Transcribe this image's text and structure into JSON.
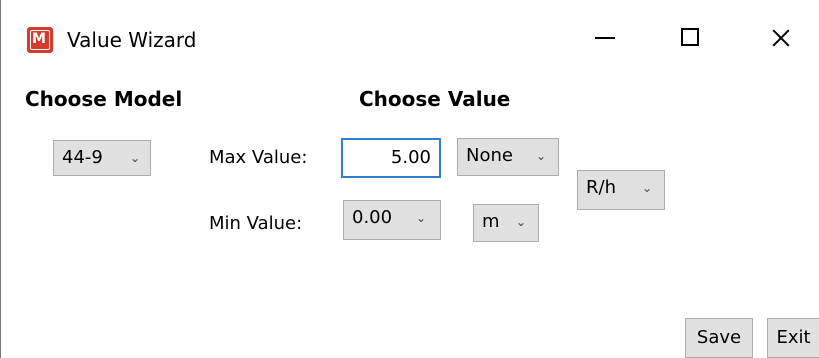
{
  "window": {
    "title": "Value Wizard",
    "icon": "app-logo-icon",
    "accent_color": "#d63a2e"
  },
  "left": {
    "heading": "Choose Model",
    "model_select": {
      "value": "44-9"
    }
  },
  "center": {
    "heading": "Choose Value",
    "max_label": "Max Value:",
    "max_value": "5.00",
    "min_label": "Min Value:",
    "min_select": {
      "value": "0.00"
    },
    "max_prefix_select": {
      "value": "None"
    },
    "min_prefix_select": {
      "value": "m"
    },
    "unit_select": {
      "value": "R/h"
    }
  },
  "footer": {
    "save_label": "Save",
    "exit_label": "Exit"
  }
}
